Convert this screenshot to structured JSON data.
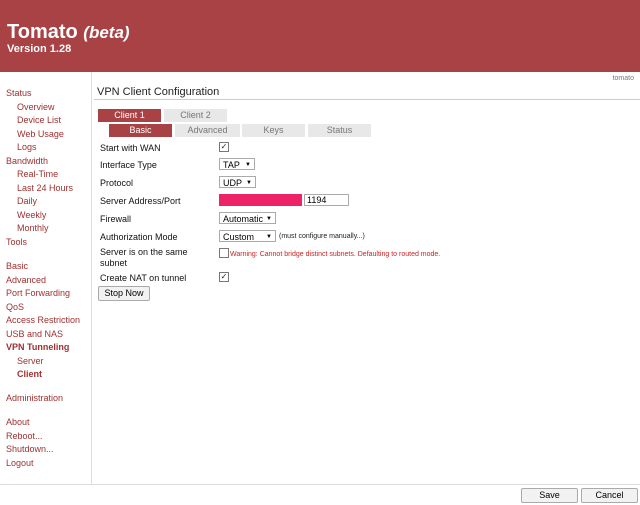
{
  "header": {
    "title": "Tomato",
    "title_suffix": "(beta)",
    "version": "Version 1.28",
    "color": "#a84244"
  },
  "router_name": "tomato",
  "page_title": "VPN Client Configuration",
  "sidebar": {
    "status": "Status",
    "overview": "Overview",
    "device_list": "Device List",
    "web_usage": "Web Usage",
    "logs": "Logs",
    "bandwidth": "Bandwidth",
    "real_time": "Real-Time",
    "last24": "Last 24 Hours",
    "daily": "Daily",
    "weekly": "Weekly",
    "monthly": "Monthly",
    "tools": "Tools",
    "basic": "Basic",
    "advanced": "Advanced",
    "port_forwarding": "Port Forwarding",
    "qos": "QoS",
    "access_restriction": "Access Restriction",
    "usb_nas": "USB and NAS",
    "vpn_tunneling": "VPN Tunneling",
    "server": "Server",
    "client": "Client",
    "administration": "Administration",
    "about": "About",
    "reboot": "Reboot...",
    "shutdown": "Shutdown...",
    "logout": "Logout"
  },
  "client_tabs": {
    "client1": "Client 1",
    "client2": "Client 2"
  },
  "sub_tabs": {
    "basic": "Basic",
    "advanced": "Advanced",
    "keys": "Keys",
    "status": "Status"
  },
  "form": {
    "start_wan_label": "Start with WAN",
    "start_wan_checked": true,
    "iface_label": "Interface Type",
    "iface_value": "TAP",
    "protocol_label": "Protocol",
    "protocol_value": "UDP",
    "server_label": "Server Address/Port",
    "server_port": "1194",
    "firewall_label": "Firewall",
    "firewall_value": "Automatic",
    "auth_label": "Authorization Mode",
    "auth_value": "Custom",
    "auth_note": "(must configure manually...)",
    "same_subnet_label": "Server is on the same subnet",
    "same_subnet_checked": false,
    "same_subnet_warning": "Warning: Cannot bridge distinct subnets. Defaulting to routed mode.",
    "nat_label": "Create NAT on tunnel",
    "nat_checked": true,
    "stop_button": "Stop Now"
  },
  "footer": {
    "save": "Save",
    "cancel": "Cancel"
  },
  "colors": {
    "accent": "#a84244",
    "link": "#a03030",
    "warning": "#cc2222",
    "redaction": "#ee2266"
  },
  "icons": {
    "checkbox_checked": "checkmark-icon",
    "dropdown": "chevron-down-icon"
  }
}
